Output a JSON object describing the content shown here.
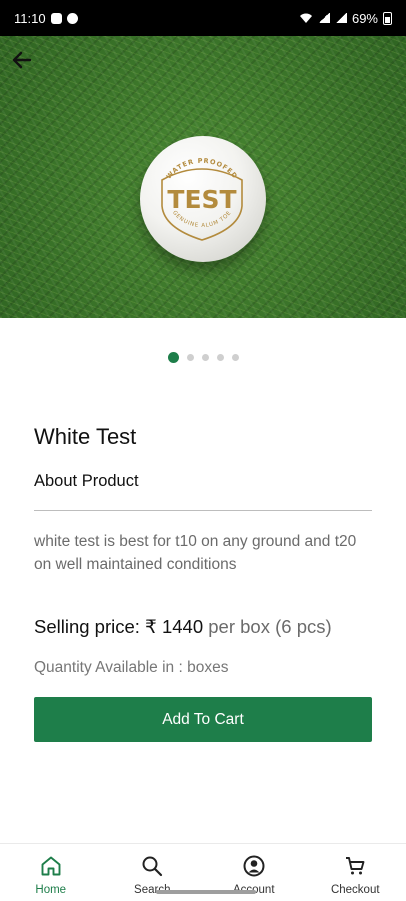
{
  "status_bar": {
    "time": "11:10",
    "battery": "69%",
    "left_icons": [
      "gallery-icon",
      "chat-icon"
    ],
    "right_icons": [
      "wifi-icon",
      "volte-icon",
      "signal-icon",
      "battery-icon"
    ]
  },
  "hero": {
    "logo_top_text": "WATER PROOFED",
    "logo_main_text": "TEST",
    "logo_bottom_text": "GENUINE ALUM TOE"
  },
  "carousel": {
    "total": 5,
    "active": 1
  },
  "product": {
    "name": "White Test",
    "about_label": "About Product",
    "description": "white test is  best for t10 on any ground and t20 on well maintained conditions",
    "price_label": "Selling price: ₹ 1440",
    "price_unit": "per box (6 pcs)",
    "quantity_text": "Quantity Available in : boxes"
  },
  "actions": {
    "add_to_cart": "Add To Cart"
  },
  "nav": {
    "items": [
      {
        "label": "Home",
        "icon": "home-icon",
        "active": true
      },
      {
        "label": "Search",
        "icon": "search-icon",
        "active": false
      },
      {
        "label": "Account",
        "icon": "account-icon",
        "active": false
      },
      {
        "label": "Checkout",
        "icon": "cart-icon",
        "active": false
      }
    ]
  },
  "colors": {
    "accent": "#1e7e4a",
    "text": "#111111",
    "muted": "#6b6b6b"
  }
}
